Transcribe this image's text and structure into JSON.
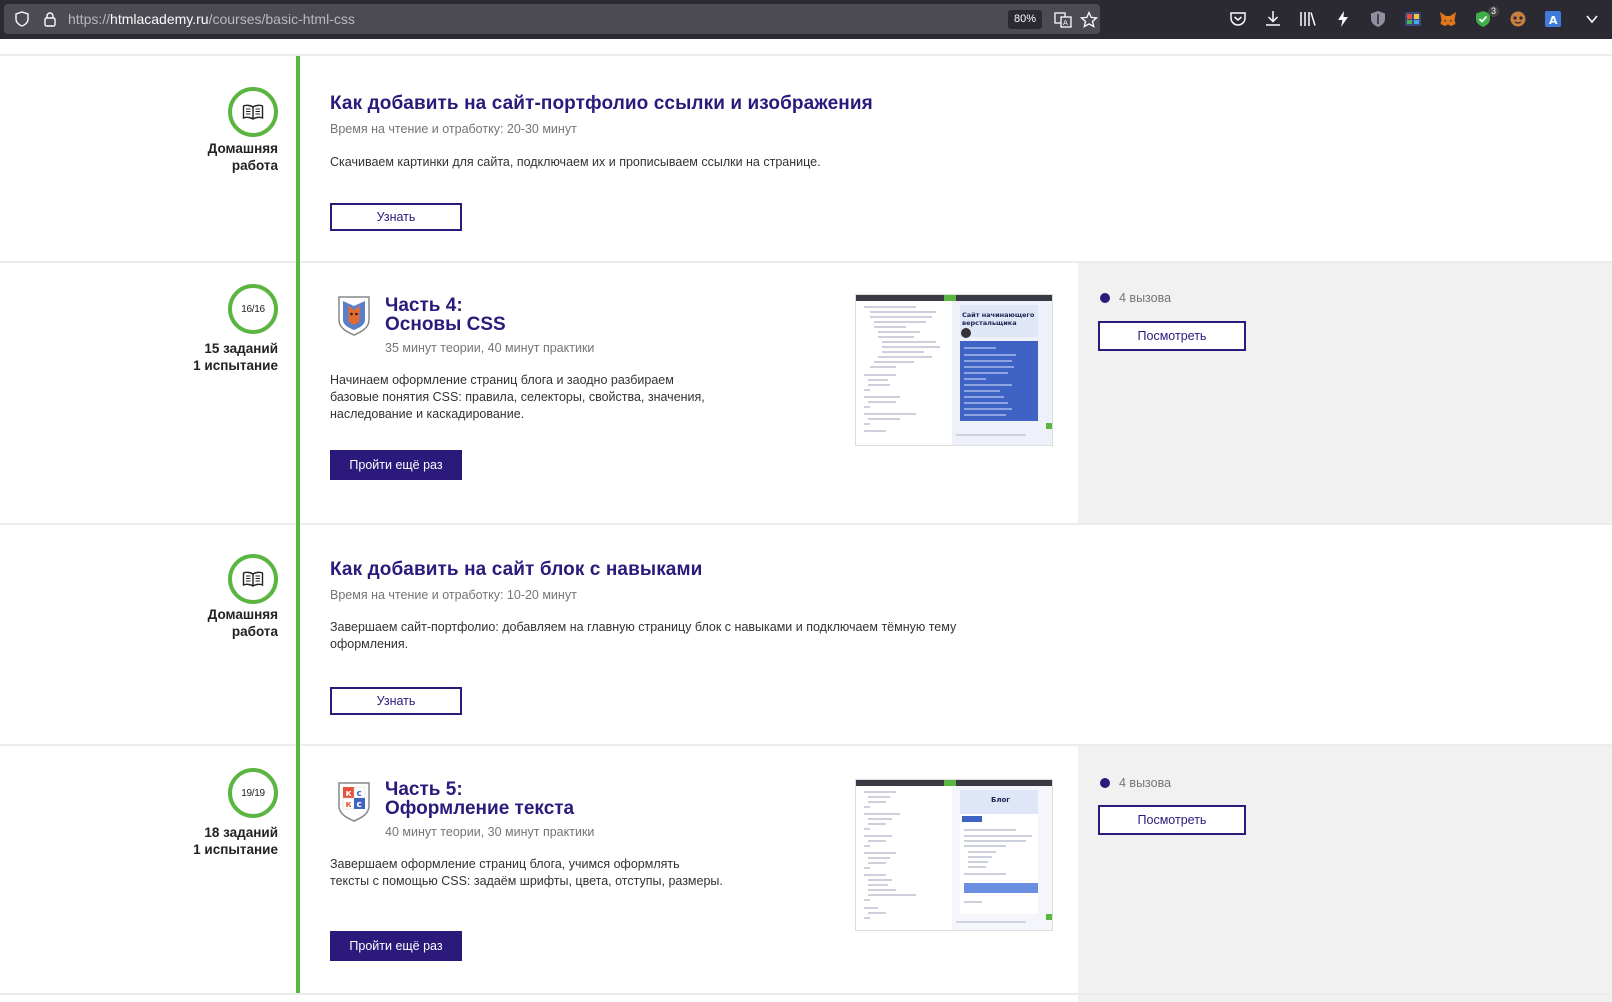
{
  "browser": {
    "url_prefix": "https://",
    "url_domain": "htmlacademy.ru",
    "url_path": "/courses/basic-html-css",
    "zoom": "80%",
    "extension_badge": "3"
  },
  "lessons": [
    {
      "kind": "homework",
      "side_label_1": "Домашняя",
      "side_label_2": "работа",
      "title": "Как добавить на сайт-портфолио ссылки и изображения",
      "meta": "Время на чтение и отработку: 20-30 минут",
      "description": "Скачиваем картинки для сайта, подключаем их и прописываем ссылки на странице.",
      "button": "Узнать"
    },
    {
      "kind": "part",
      "progress": "16/16",
      "side_label_1": "15 заданий",
      "side_label_2": "1 испытание",
      "title_1": "Часть 4:",
      "title_2": "Основы CSS",
      "meta": "35 минут теории, 40 минут практики",
      "description_1": "Начинаем оформление страниц блога и заодно разбираем",
      "description_2": "базовые понятия CSS: правила, селекторы, свойства, значения,",
      "description_3": "наследование и каскадирование.",
      "button": "Пройти ещё раз",
      "challenges": "4 вызова",
      "view_button": "Посмотреть",
      "thumb_heading_1": "Сайт начинающего",
      "thumb_heading_2": "верстальщика"
    },
    {
      "kind": "homework",
      "side_label_1": "Домашняя",
      "side_label_2": "работа",
      "title": "Как добавить на сайт блок с навыками",
      "meta": "Время на чтение и отработку: 10-20 минут",
      "description_1": "Завершаем сайт-портфолио: добавляем на главную страницу блок с навыками и подключаем тёмную тему",
      "description_2": "оформления.",
      "button": "Узнать"
    },
    {
      "kind": "part",
      "progress": "19/19",
      "side_label_1": "18 заданий",
      "side_label_2": "1 испытание",
      "title_1": "Часть 5:",
      "title_2": "Оформление текста",
      "meta": "40 минут теории, 30 минут практики",
      "description_1": "Завершаем оформление страниц блога, учимся оформлять",
      "description_2": "тексты с помощью CSS: задаём шрифты, цвета, отступы, размеры.",
      "button": "Пройти ещё раз",
      "challenges": "4 вызова",
      "view_button": "Посмотреть",
      "thumb_heading": "Блог",
      "logo_letters": [
        "к",
        "с",
        "к",
        "с"
      ]
    }
  ],
  "colors": {
    "brand": "#2b1a7c",
    "timeline_green": "#5ab541",
    "panel_grey": "#f1f1f1"
  }
}
